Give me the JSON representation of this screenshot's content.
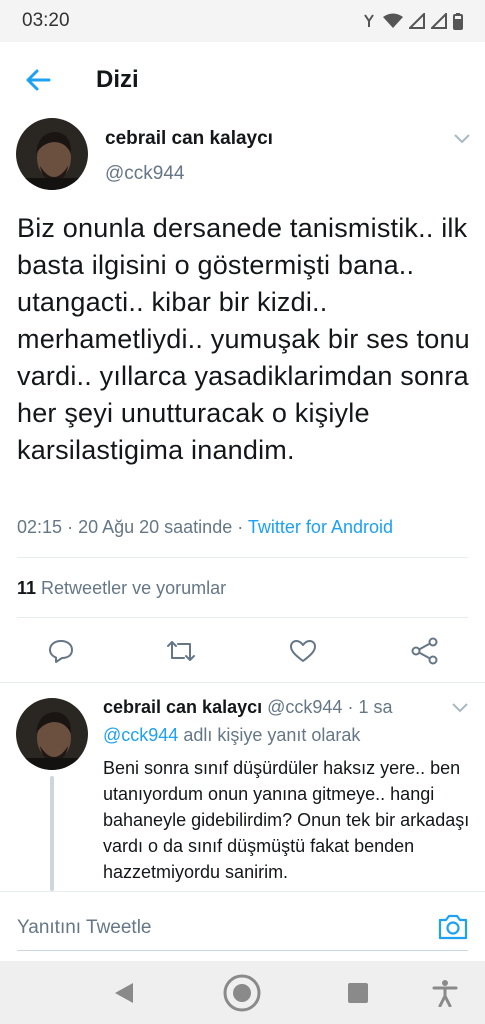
{
  "status_bar": {
    "time": "03:20"
  },
  "header": {
    "title": "Dizi"
  },
  "tweet": {
    "author_name": "cebrail can kalaycı",
    "author_handle": "@cck944",
    "text": "Biz onunla dersanede tanismistik.. ilk basta ilgisini o göstermişti bana..  utangacti.. kibar bir kizdi.. merhametliydi.. yumuşak bir ses tonu vardi.. yıllarca yasadiklarimdan sonra her şeyi unutturacak o kişiyle karsilastigima inandim.",
    "time": "02:15",
    "date": "20 Ağu 20 saatinde",
    "separator": "·",
    "client": "Twitter for Android",
    "retweet_count": "11",
    "retweet_label": "Retweetler ve yorumlar"
  },
  "reply": {
    "author_name": "cebrail can kalaycı",
    "author_handle": "@cck944",
    "age": "1 sa",
    "reply_to_mention": "@cck944",
    "reply_to_suffix": "adlı kişiye yanıt olarak",
    "text": "Beni sonra sınıf düşürdüler haksız yere.. ben utanıyordum onun yanına gitmeye.. hangi bahaneyle gidebilirdim? Onun tek bir arkadaşı vardı o da sınıf düşmüştü fakat benden hazzetmiyordu sanirim."
  },
  "compose": {
    "placeholder": "Yanıtını Tweetle"
  },
  "colors": {
    "accent": "#1da1f2",
    "secondary_text": "#657786",
    "primary_text": "#14171a"
  },
  "icons": {
    "back": "arrow-left-icon",
    "caret": "chevron-down-icon",
    "reply": "comment-icon",
    "retweet": "retweet-icon",
    "like": "heart-icon",
    "share": "share-icon",
    "camera": "camera-icon"
  }
}
